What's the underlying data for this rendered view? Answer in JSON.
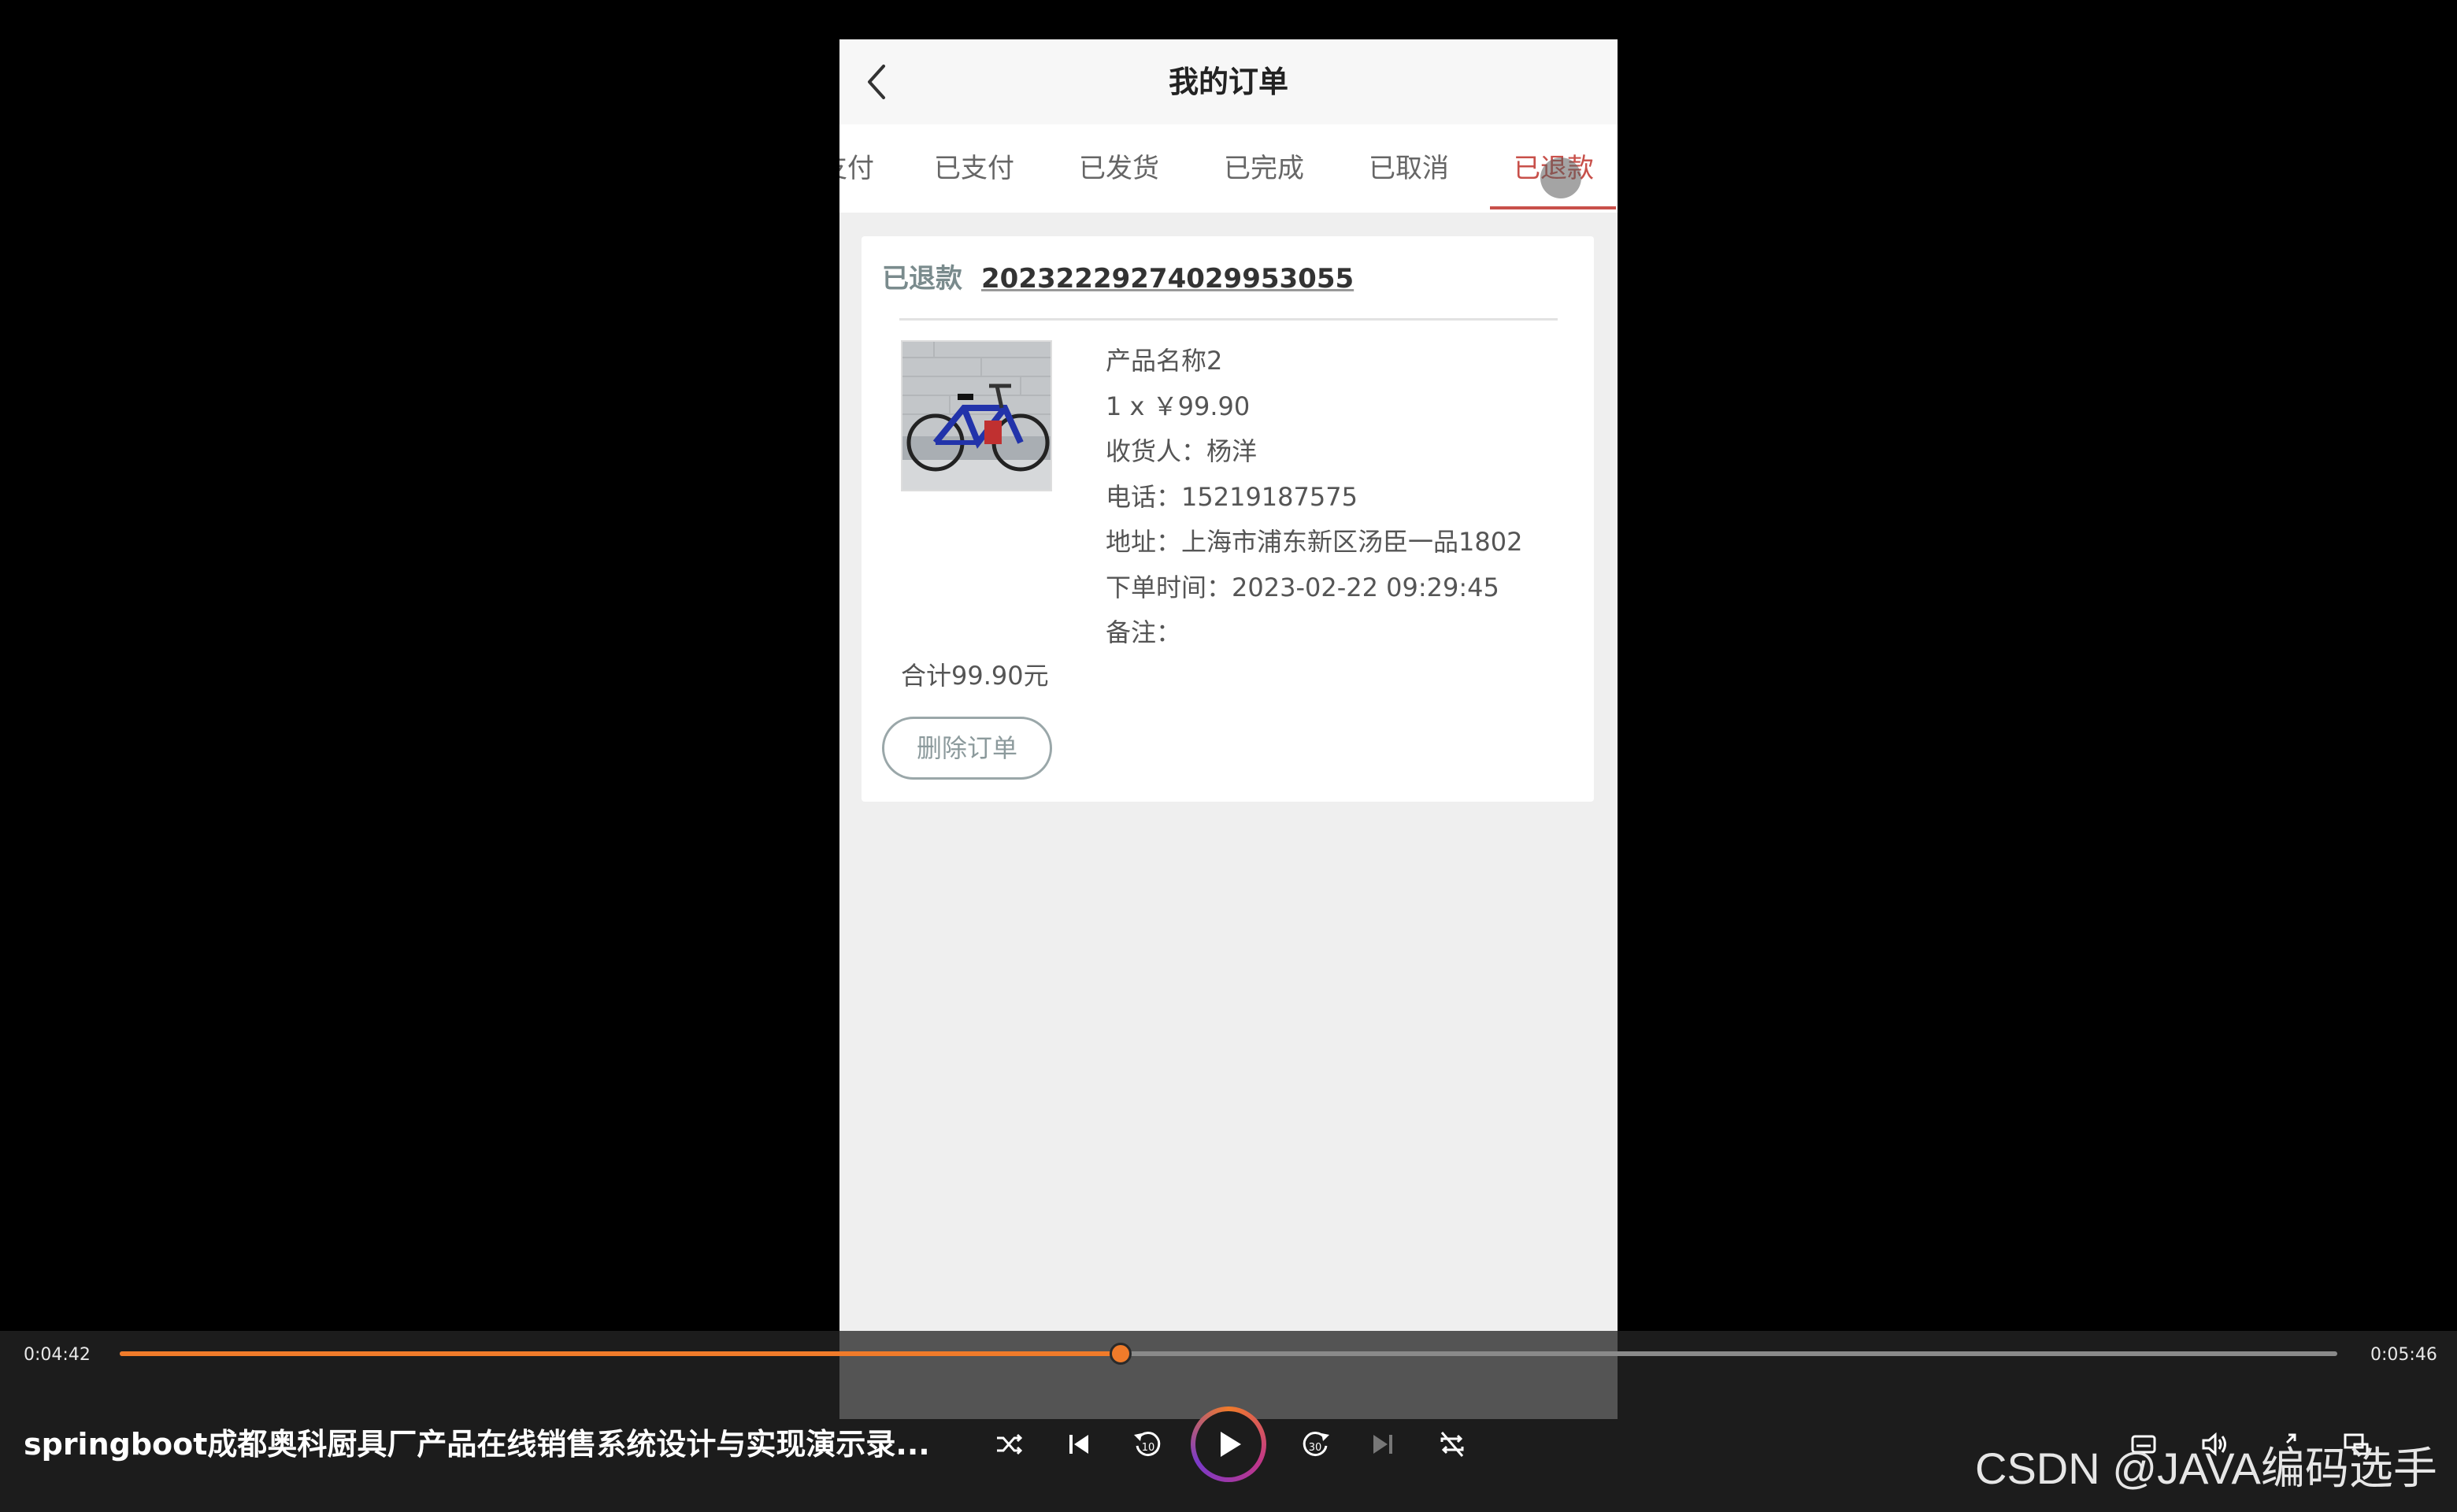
{
  "nav": {
    "title": "我的订单"
  },
  "tabs": [
    {
      "label": "支付",
      "active": false
    },
    {
      "label": "已支付",
      "active": false
    },
    {
      "label": "已发货",
      "active": false
    },
    {
      "label": "已完成",
      "active": false
    },
    {
      "label": "已取消",
      "active": false
    },
    {
      "label": "已退款",
      "active": true
    }
  ],
  "order": {
    "status": "已退款",
    "order_no": "20232229274029953055",
    "product_name": "产品名称2",
    "qty_price": "1 x ￥99.90",
    "receiver": "收货人：杨洋",
    "phone": "电话：15219187575",
    "address": "地址：上海市浦东新区汤臣一品1802",
    "order_time": "下单时间：2023-02-22 09:29:45",
    "note": "备注：",
    "total": "合计99.90元",
    "delete_label": "删除订单"
  },
  "player": {
    "current_time": "0:04:42",
    "duration": "0:05:46",
    "progress_fraction": 0.4512,
    "title": "springboot成都奥科厨具厂产品在线销售系统设计与实现演示录...",
    "accent": "#f07b2a"
  },
  "watermark": "CSDN @JAVA编码选手",
  "colors": {
    "active_tab": "#c8504a",
    "status_text": "#7a8b8d"
  }
}
